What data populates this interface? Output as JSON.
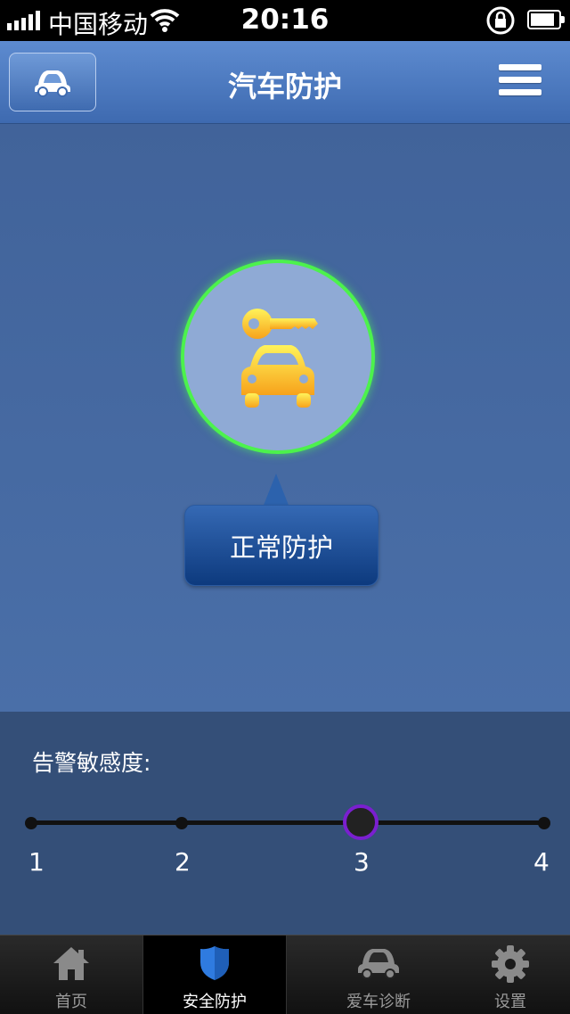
{
  "status_bar": {
    "carrier": "中国移动",
    "time": "20:16"
  },
  "header": {
    "title": "汽车防护",
    "left_icon": "car-icon",
    "right_icon": "menu-icon"
  },
  "protection": {
    "status_label": "正常防护",
    "icon": "key-car-icon",
    "ring_color": "#4cf24c"
  },
  "sensitivity": {
    "label": "告警敏感度:",
    "levels": [
      "1",
      "2",
      "3",
      "4"
    ],
    "selected": "3"
  },
  "tabs": [
    {
      "label": "首页",
      "icon": "home-icon",
      "active": false
    },
    {
      "label": "安全防护",
      "icon": "shield-icon",
      "active": true
    },
    {
      "label": "爱车诊断",
      "icon": "car-icon",
      "active": false
    },
    {
      "label": "设置",
      "icon": "gear-icon",
      "active": false
    }
  ]
}
